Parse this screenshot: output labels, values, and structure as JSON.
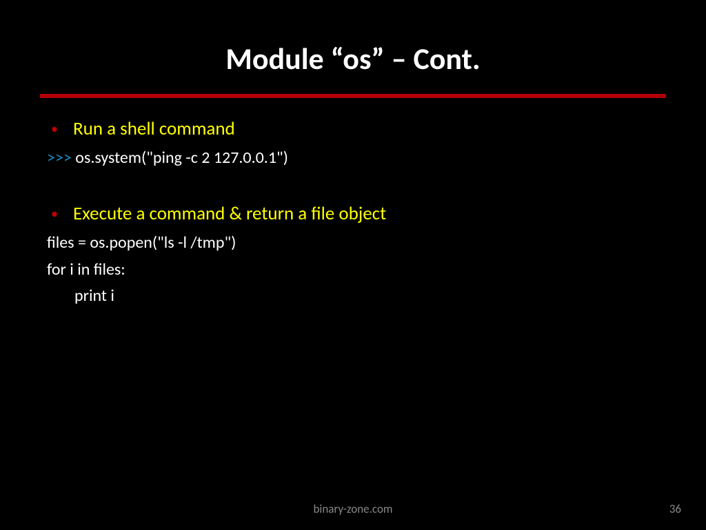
{
  "title": "Module “os” – Cont.",
  "section1": {
    "heading": "Run a shell command",
    "code": {
      "prompt": ">>> ",
      "line": "os.system(\"ping -c 2 127.0.0.1\")"
    }
  },
  "section2": {
    "heading": "Execute a command & return a file object",
    "code": {
      "line1": "files = os.popen(\"ls -l /tmp\")",
      "line2": "for i in files:",
      "line3": "print i"
    }
  },
  "footer": "binary-zone.com",
  "pageNumber": "36"
}
